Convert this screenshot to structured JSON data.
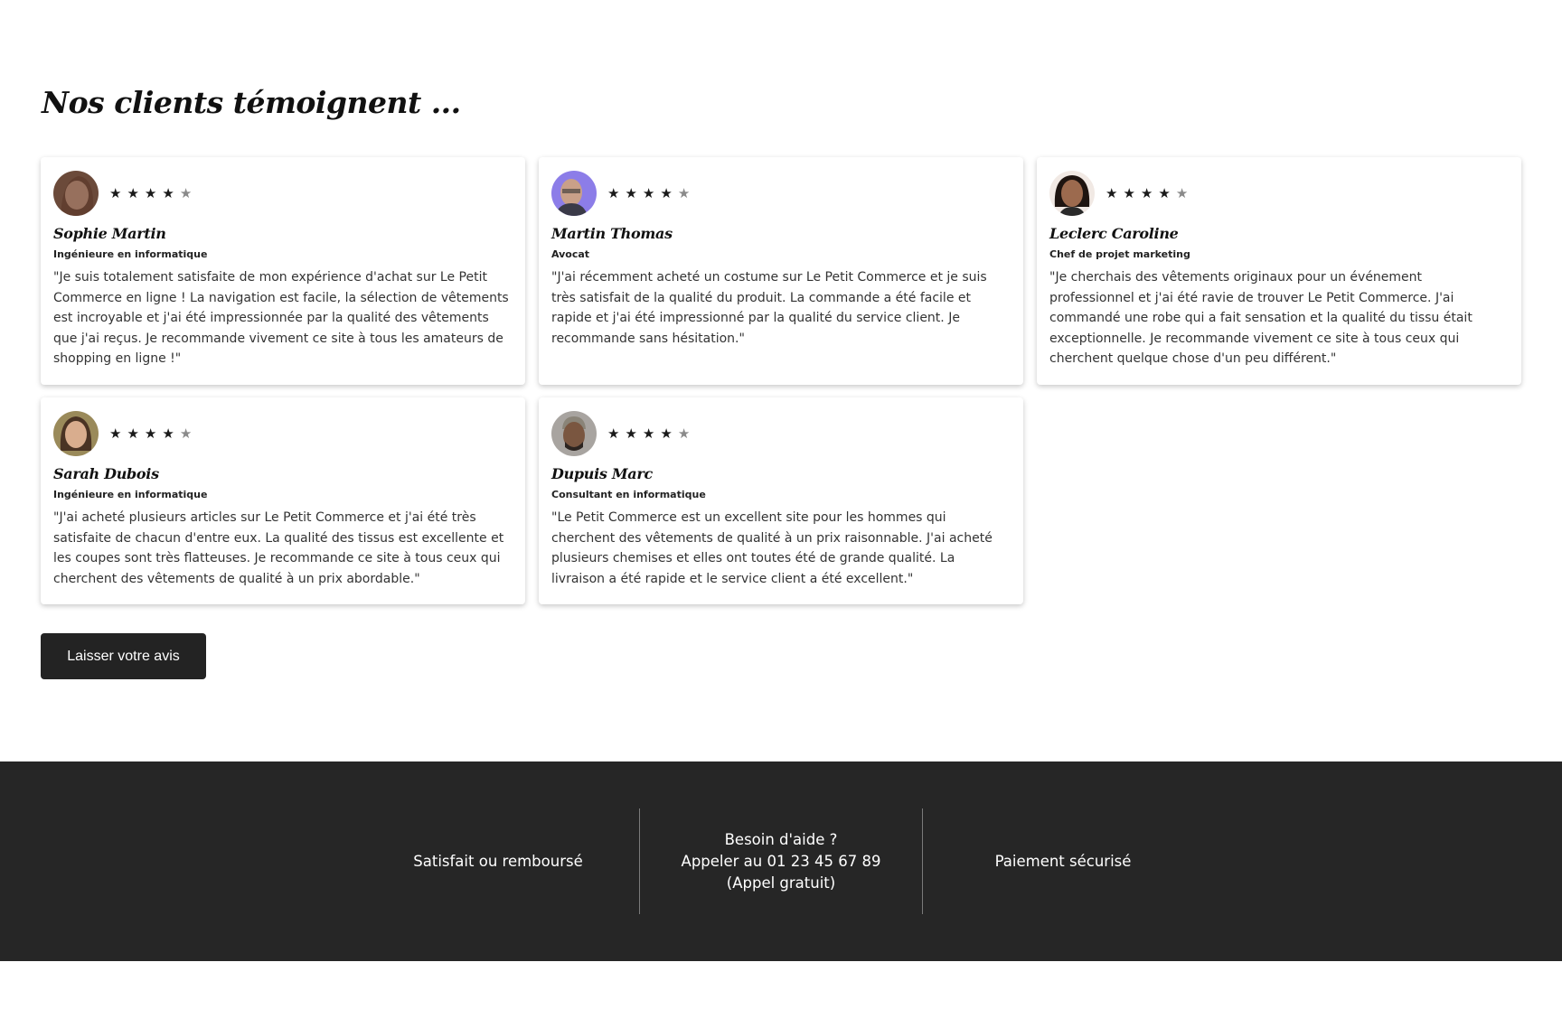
{
  "section": {
    "title": "Nos clients témoignent ..."
  },
  "testimonials": [
    {
      "name": "Sophie Martin",
      "role": "Ingénieure en informatique",
      "rating": 4,
      "max_rating": 5,
      "quote": "\"Je suis totalement satisfaite de mon expérience d'achat sur Le Petit Commerce en ligne ! La navigation est facile, la sélection de vêtements est incroyable et j'ai été impressionnée par la qualité des vêtements que j'ai reçus. Je recommande vivement ce site à tous les amateurs de shopping en ligne !\""
    },
    {
      "name": "Martin Thomas",
      "role": "Avocat",
      "rating": 4,
      "max_rating": 5,
      "quote": "\"J'ai récemment acheté un costume sur Le Petit Commerce et je suis très satisfait de la qualité du produit. La commande a été facile et rapide et j'ai été impressionné par la qualité du service client. Je recommande sans hésitation.\""
    },
    {
      "name": "Leclerc Caroline",
      "role": "Chef de projet marketing",
      "rating": 4,
      "max_rating": 5,
      "quote": "\"Je cherchais des vêtements originaux pour un événement professionnel et j'ai été ravie de trouver Le Petit Commerce. J'ai commandé une robe qui a fait sensation et la qualité du tissu était exceptionnelle. Je recommande vivement ce site à tous ceux qui cherchent quelque chose d'un peu différent.\""
    },
    {
      "name": "Sarah Dubois",
      "role": "Ingénieure en informatique",
      "rating": 4,
      "max_rating": 5,
      "quote": "\"J'ai acheté plusieurs articles sur Le Petit Commerce et j'ai été très satisfaite de chacun d'entre eux. La qualité des tissus est excellente et les coupes sont très flatteuses. Je recommande ce site à tous ceux qui cherchent des vêtements de qualité à un prix abordable.\""
    },
    {
      "name": "Dupuis Marc",
      "role": "Consultant en informatique",
      "rating": 4,
      "max_rating": 5,
      "quote": "\"Le Petit Commerce est un excellent site pour les hommes qui cherchent des vêtements de qualité à un prix raisonnable. J'ai acheté plusieurs chemises et elles ont toutes été de grande qualité. La livraison a été rapide et le service client a été excellent.\""
    }
  ],
  "cta": {
    "label": "Laisser votre avis"
  },
  "footer": {
    "left": "Satisfait ou remboursé",
    "center_line1": "Besoin d'aide ?",
    "center_line2": "Appeler au 01 23 45 67 89",
    "center_line3": "(Appel gratuit)",
    "right": "Paiement sécurisé"
  }
}
